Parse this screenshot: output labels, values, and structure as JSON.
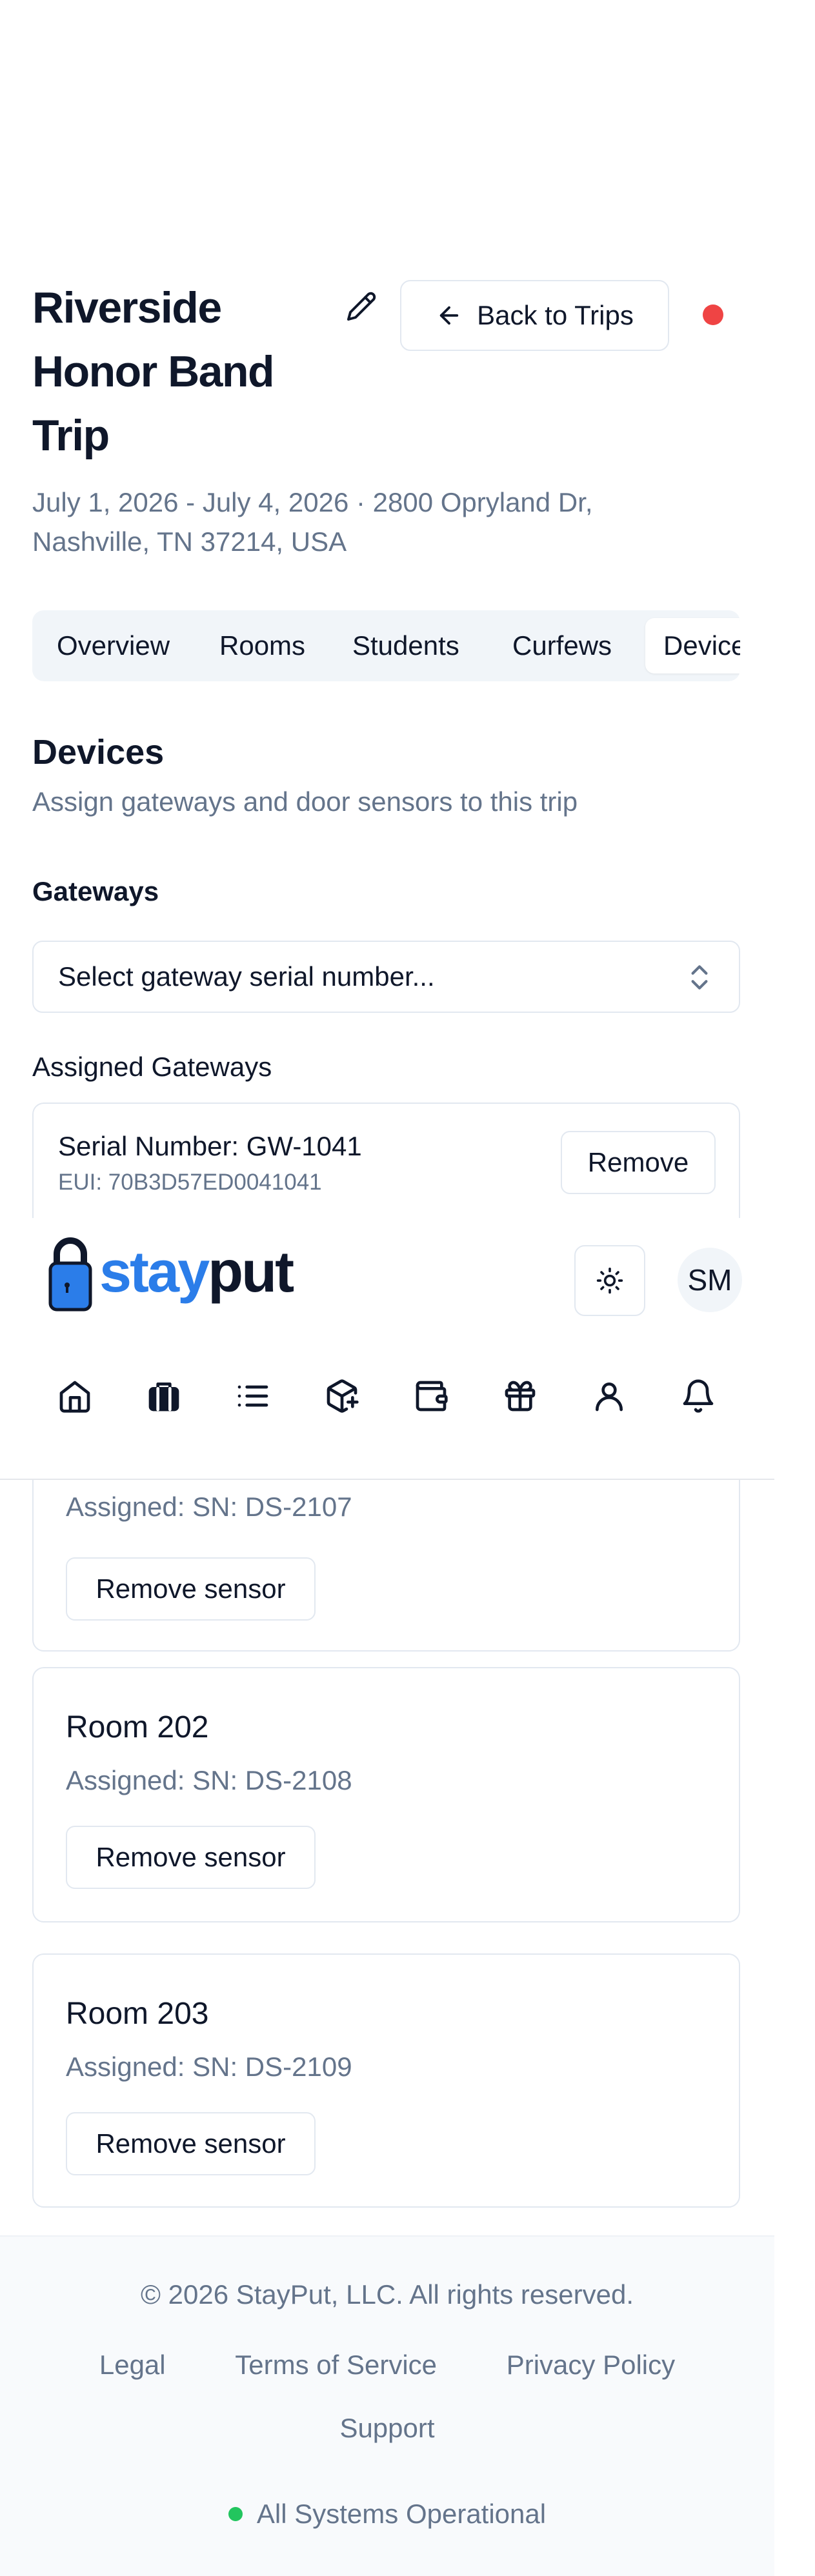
{
  "trip": {
    "title": "Riverside Honor Band Trip",
    "subtitle": "July 1, 2026 - July 4, 2026 · 2800 Opryland Dr, Nashville, TN 37214, USA",
    "back_label": "Back to Trips",
    "status_color": "#ef4444"
  },
  "tabs": [
    {
      "label": "Overview"
    },
    {
      "label": "Rooms"
    },
    {
      "label": "Students"
    },
    {
      "label": "Curfews"
    },
    {
      "label": "Devices",
      "active": true
    }
  ],
  "devices": {
    "title": "Devices",
    "description": "Assign gateways and door sensors to this trip",
    "gateways_label": "Gateways",
    "gateway_select_placeholder": "Select gateway serial number...",
    "assigned_gateways_label": "Assigned Gateways",
    "assigned_gateways": [
      {
        "serial": "Serial Number: GW-1041",
        "eui": "EUI: 70B3D57ED0041041",
        "remove_label": "Remove"
      }
    ]
  },
  "app_header": {
    "logo_stay": "stay",
    "logo_put": "put",
    "brand_color": "#2b7de9",
    "avatar_initials": "SM",
    "theme_icon": "sun-icon",
    "nav": [
      {
        "icon": "home-icon"
      },
      {
        "icon": "luggage-icon"
      },
      {
        "icon": "list-icon"
      },
      {
        "icon": "package-plus-icon"
      },
      {
        "icon": "wallet-icon"
      },
      {
        "icon": "gift-icon"
      },
      {
        "icon": "user-icon"
      },
      {
        "icon": "bell-icon"
      }
    ]
  },
  "rooms": [
    {
      "name": "",
      "assigned": "Assigned: SN: DS-2107",
      "button": "Remove sensor"
    },
    {
      "name": "Room 202",
      "assigned": "Assigned: SN: DS-2108",
      "button": "Remove sensor"
    },
    {
      "name": "Room 203",
      "assigned": "Assigned: SN: DS-2109",
      "button": "Remove sensor"
    }
  ],
  "footer": {
    "copyright": "© 2026 StayPut, LLC. All rights reserved.",
    "links": [
      "Legal",
      "Terms of Service",
      "Privacy Policy"
    ],
    "support": "Support",
    "status": "All Systems Operational",
    "status_color": "#22c55e"
  }
}
